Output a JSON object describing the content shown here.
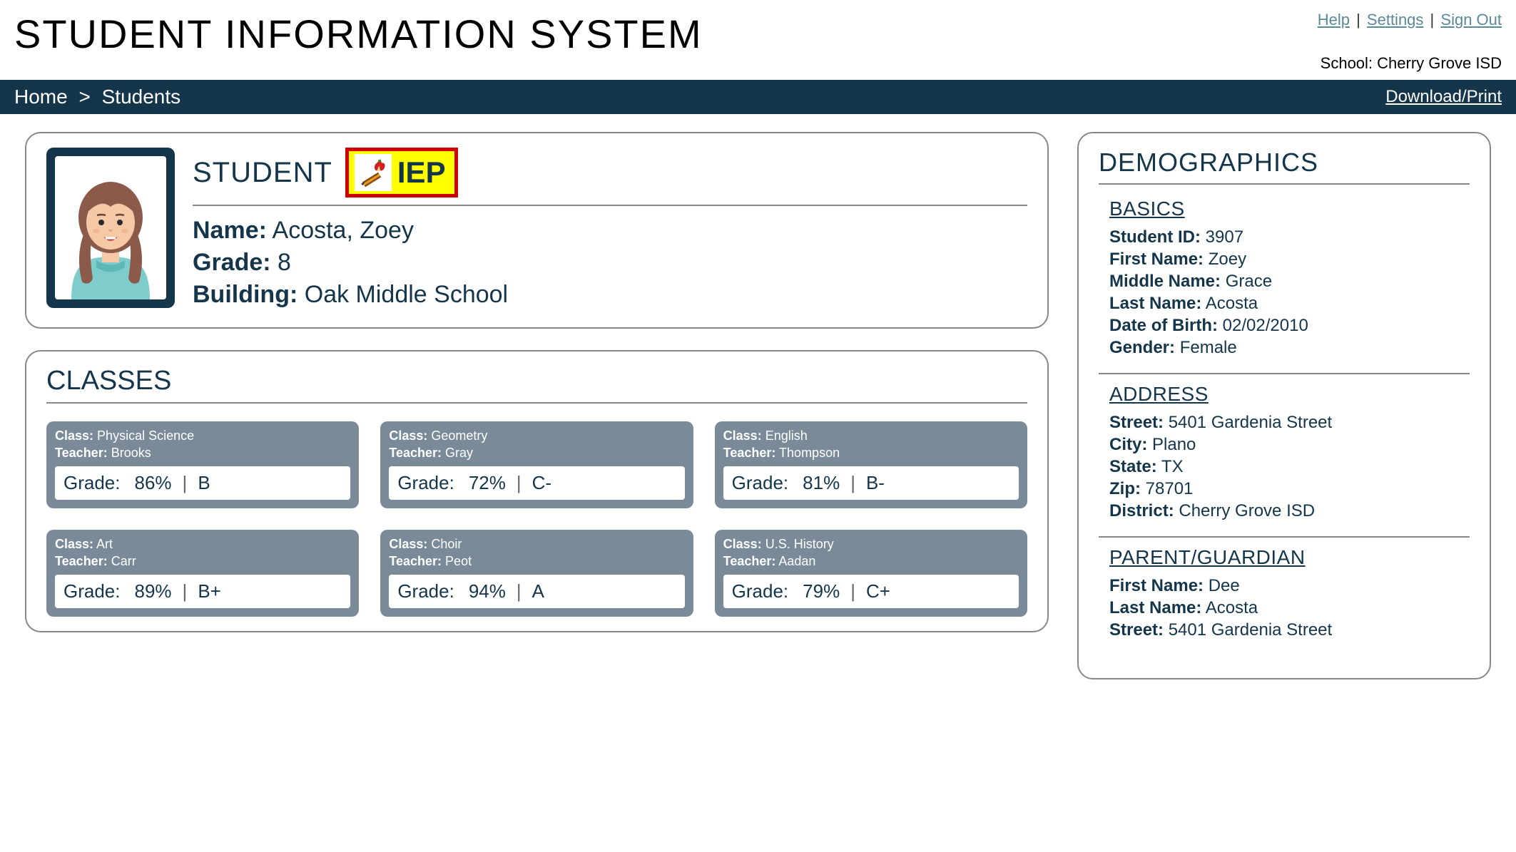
{
  "header": {
    "title": "STUDENT INFORMATION SYSTEM",
    "links": {
      "help": "Help",
      "settings": "Settings",
      "signout": "Sign Out"
    },
    "school_label": "School:",
    "school_name": "Cherry Grove ISD"
  },
  "nav": {
    "home": "Home",
    "students": "Students",
    "download": "Download/Print"
  },
  "student": {
    "heading": "STUDENT",
    "iep": "IEP",
    "name_label": "Name:",
    "name_value": "Acosta, Zoey",
    "grade_label": "Grade:",
    "grade_value": "8",
    "building_label": "Building:",
    "building_value": "Oak Middle School"
  },
  "classes": {
    "heading": "CLASSES",
    "class_label": "Class:",
    "teacher_label": "Teacher:",
    "grade_label": "Grade:",
    "items": [
      {
        "cls": "Physical Science",
        "teacher": "Brooks",
        "pct": "86%",
        "letter": "B"
      },
      {
        "cls": "Geometry",
        "teacher": "Gray",
        "pct": "72%",
        "letter": "C-"
      },
      {
        "cls": "English",
        "teacher": "Thompson",
        "pct": "81%",
        "letter": "B-"
      },
      {
        "cls": "Art",
        "teacher": "Carr",
        "pct": "89%",
        "letter": "B+"
      },
      {
        "cls": "Choir",
        "teacher": "Peot",
        "pct": "94%",
        "letter": "A"
      },
      {
        "cls": "U.S. History",
        "teacher": "Aadan",
        "pct": "79%",
        "letter": "C+"
      }
    ]
  },
  "demographics": {
    "heading": "DEMOGRAPHICS",
    "basics": {
      "heading": "BASICS",
      "student_id_label": "Student ID:",
      "student_id": "3907",
      "first_name_label": "First Name:",
      "first_name": "Zoey",
      "middle_name_label": "Middle Name:",
      "middle_name": "Grace",
      "last_name_label": "Last Name:",
      "last_name": "Acosta",
      "dob_label": "Date of Birth:",
      "dob": "02/02/2010",
      "gender_label": "Gender:",
      "gender": "Female"
    },
    "address": {
      "heading": "ADDRESS",
      "street_label": "Street:",
      "street": "5401 Gardenia Street",
      "city_label": "City:",
      "city": "Plano",
      "state_label": "State:",
      "state": "TX",
      "zip_label": "Zip:",
      "zip": "78701",
      "district_label": "District:",
      "district": "Cherry Grove ISD"
    },
    "guardian": {
      "heading": "PARENT/GUARDIAN",
      "first_name_label": "First Name:",
      "first_name": "Dee",
      "last_name_label": "Last Name:",
      "last_name": "Acosta",
      "street_label": "Street:",
      "street": "5401 Gardenia Street"
    }
  }
}
